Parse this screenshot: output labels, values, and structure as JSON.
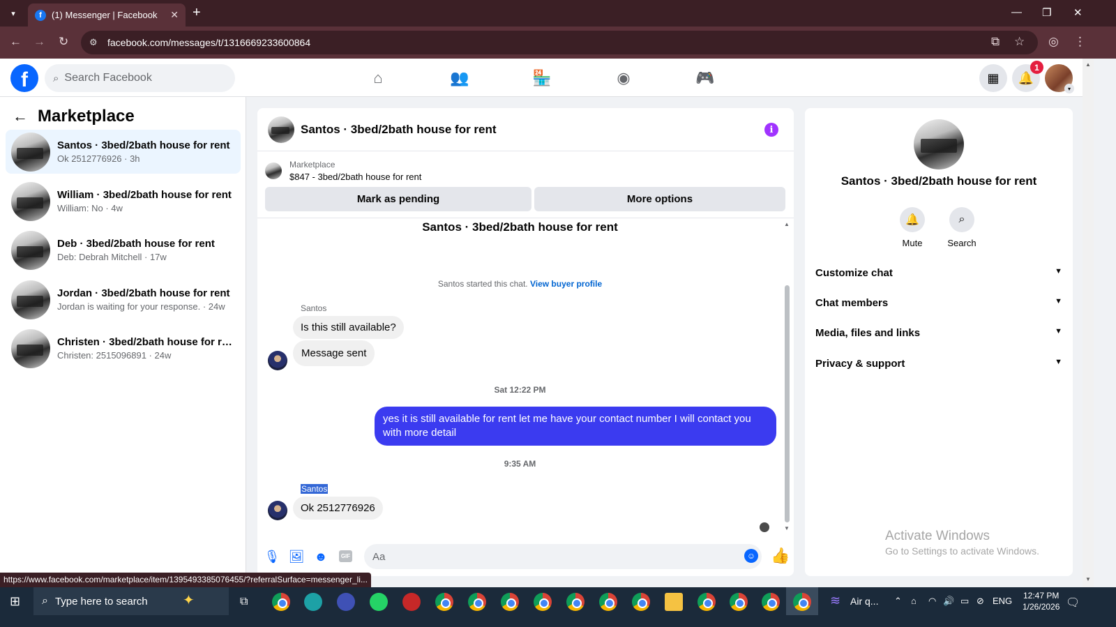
{
  "browser": {
    "tab_title": "(1) Messenger | Facebook",
    "tab_favicon": "f",
    "url": "facebook.com/messages/t/1316669233600864",
    "status_url": "https://www.facebook.com/marketplace/item/1395493385076455/?referralSurface=messenger_li..."
  },
  "fb": {
    "search_placeholder": "Search Facebook",
    "notification_count": "1",
    "logo_letter": "f"
  },
  "left": {
    "title": "Marketplace",
    "conversations": [
      {
        "name": "Santos · 3bed/2bath house for rent",
        "snippet": "Ok 2512776926 · 3h",
        "selected": true
      },
      {
        "name": "William · 3bed/2bath house for rent",
        "snippet": "William: No · 4w",
        "selected": false
      },
      {
        "name": "Deb · 3bed/2bath house for rent",
        "snippet": "Deb: Debrah Mitchell · 17w",
        "selected": false
      },
      {
        "name": "Jordan · 3bed/2bath house for rent",
        "snippet": "Jordan is waiting for your response. · 24w",
        "selected": false
      },
      {
        "name": "Christen · 3bed/2bath house for re...",
        "snippet": "Christen: 2515096891 · 24w",
        "selected": false
      }
    ]
  },
  "chat": {
    "header_name": "Santos · 3bed/2bath house for rent",
    "marketplace_label": "Marketplace",
    "listing": "$847 - 3bed/2bath house for rent",
    "mark_pending": "Mark as pending",
    "more_options": "More options",
    "conversation_title": "Santos · 3bed/2bath house for rent",
    "started_text": "Santos started this chat.",
    "view_buyer": "View buyer profile",
    "sender1": "Santos",
    "msg1": "Is this still available?",
    "msg2": "Message sent",
    "time1": "Sat 12:22 PM",
    "out_msg": "yes it is still available for rent let me have your contact number I will contact you with more detail",
    "time2": "9:35 AM",
    "sender2": "Santos",
    "msg3": "Ok 2512776926",
    "composer_placeholder": "Aa",
    "gif_label": "GIF"
  },
  "right": {
    "name": "Santos · 3bed/2bath house for rent",
    "mute_label": "Mute",
    "search_label": "Search",
    "sections": [
      "Customize chat",
      "Chat members",
      "Media, files and links",
      "Privacy & support"
    ],
    "activate_title": "Activate Windows",
    "activate_sub": "Go to Settings to activate Windows."
  },
  "taskbar": {
    "search_placeholder": "Type here to search",
    "weather": "Air q...",
    "lang": "ENG",
    "time": "12:47 PM",
    "date": "1/26/2026"
  },
  "colors": {
    "accent": "#0866ff",
    "outgoing_bubble": "#3b3bf0",
    "info_icon": "#a033ff",
    "browser_frame": "#5a3139"
  }
}
